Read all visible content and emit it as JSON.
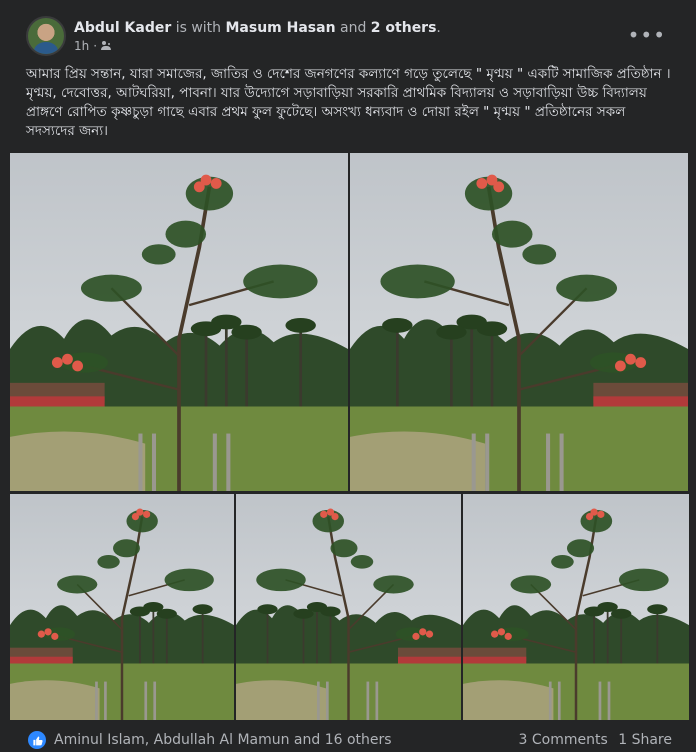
{
  "post": {
    "author": "Abdul Kader",
    "with_text": "is with",
    "tagged_person": "Masum Hasan",
    "and_text": "and",
    "others_link": "2 others",
    "period": ".",
    "time": "1h",
    "separator": "·",
    "audience_icon": "friends-icon",
    "more_icon": "more-options-icon",
    "more_glyph": "•••",
    "text": "আমার প্রিয় সন্তান,  যারা সমাজের,  জাতির ও দেশের জনগণের কল্যাণে গড়ে তুলেছে \" মৃণ্ময় \" একটি সামাজিক প্রতিষ্ঠান ।  মৃণ্ময়,  দেবোত্তর,  আটঘরিয়া, পাবনা।  যার উদ্যোগে সড়াবাড়িয়া সরকারি প্রাথমিক বিদ্যালয় ও সড়াবাড়িয়া উচ্চ বিদ্যালয় প্রাঙ্গণে রোপিত  কৃষ্ণচুড়া গাছে এবার প্রথম ফুল ফুটেছে। অসংখ্য ধন্যবাদ ও দোয়া রইল \" মৃণ্ময় \" প্রতিষ্ঠানের সকল সদস্যদের জন্য।"
  },
  "photos": [
    {
      "name": "photo-1",
      "subject": "young krishnachura tree with red flowers"
    },
    {
      "name": "photo-2",
      "subject": "young krishnachura tree with red flowers"
    },
    {
      "name": "photo-3",
      "subject": "young krishnachura tree with red flowers"
    },
    {
      "name": "photo-4",
      "subject": "young krishnachura tree with red flowers"
    },
    {
      "name": "photo-5",
      "subject": "young krishnachura tree with red flowers"
    }
  ],
  "footer": {
    "like_icon": "like-icon",
    "reactors": "Aminul Islam, Abdullah Al Mamun and 16 others",
    "comments": "3 Comments",
    "shares": "1 Share"
  },
  "colors": {
    "background": "#242526",
    "text_primary": "#e4e6eb",
    "text_secondary": "#b0b3b8",
    "like_blue": "#2d88ff",
    "flower_red": "#e05a4a",
    "grass_green": "#6f8a3f"
  }
}
